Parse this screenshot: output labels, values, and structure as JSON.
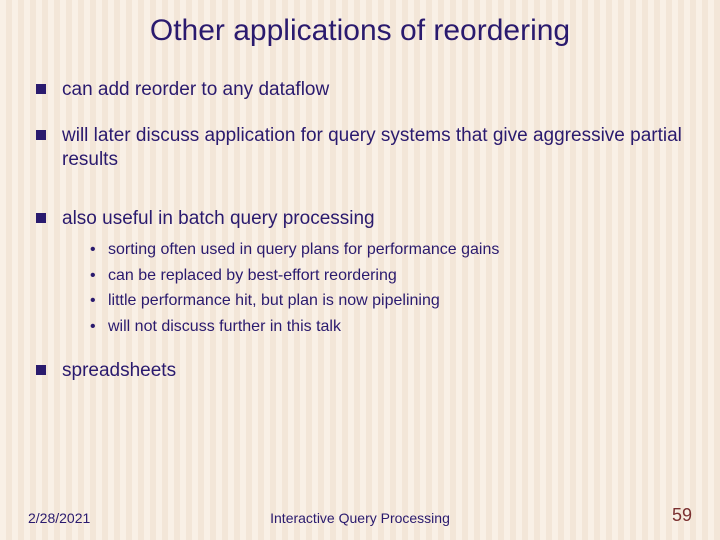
{
  "title": "Other applications of reordering",
  "bullets": {
    "b1": "can add reorder to any dataflow",
    "b2": "will later discuss application for query systems that give aggressive partial results",
    "b3": "also useful in batch query processing",
    "b3_sub": {
      "s1": "sorting often used in query plans for performance gains",
      "s2": "can be replaced by best-effort reordering",
      "s3": "little performance hit, but plan is now pipelining",
      "s4": "will not discuss further in this talk"
    },
    "b4": "spreadsheets"
  },
  "footer": {
    "date": "2/28/2021",
    "center": "Interactive Query Processing",
    "page": "59"
  }
}
